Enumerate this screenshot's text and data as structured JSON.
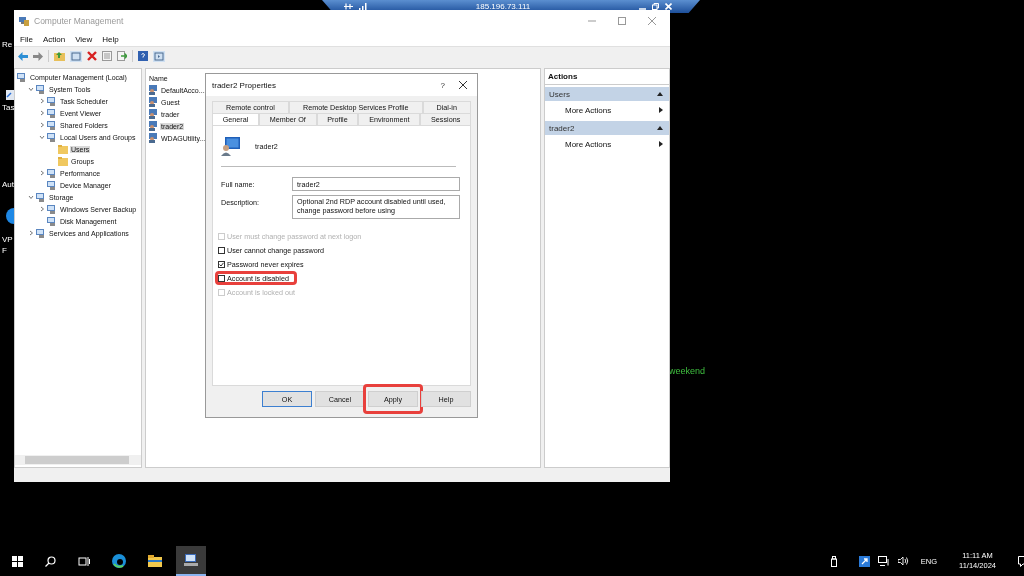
{
  "desktop": {
    "icon_labels": [
      "Re",
      "Tas",
      "Aut",
      "VP",
      "F"
    ],
    "note_text": "weekend"
  },
  "remote_bar": {
    "address": "185.196.73.111"
  },
  "window": {
    "title": "Computer Management",
    "menu": [
      "File",
      "Action",
      "View",
      "Help"
    ]
  },
  "tree": [
    {
      "label": "Computer Management (Local)",
      "selected": false,
      "children": [
        {
          "label": "System Tools",
          "selected": false,
          "expanded": true,
          "children": [
            {
              "label": "Task Scheduler",
              "selected": false,
              "expanded": false
            },
            {
              "label": "Event Viewer",
              "selected": false,
              "expanded": false
            },
            {
              "label": "Shared Folders",
              "selected": false,
              "expanded": false
            },
            {
              "label": "Local Users and Groups",
              "selected": false,
              "expanded": true,
              "children": [
                {
                  "label": "Users",
                  "selected": true
                },
                {
                  "label": "Groups",
                  "selected": false
                }
              ]
            },
            {
              "label": "Performance",
              "selected": false,
              "expanded": false
            },
            {
              "label": "Device Manager",
              "selected": false
            }
          ]
        },
        {
          "label": "Storage",
          "selected": false,
          "expanded": true,
          "children": [
            {
              "label": "Windows Server Backup",
              "selected": false,
              "expanded": false
            },
            {
              "label": "Disk Management",
              "selected": false
            }
          ]
        },
        {
          "label": "Services and Applications",
          "selected": false,
          "expanded": false
        }
      ]
    }
  ],
  "list": {
    "columns": [
      "Name"
    ],
    "rows": [
      {
        "name": "DefaultAcco...",
        "selected": false
      },
      {
        "name": "Guest",
        "selected": false
      },
      {
        "name": "trader",
        "selected": false
      },
      {
        "name": "trader2",
        "selected": true
      },
      {
        "name": "WDAGUtility...",
        "selected": false
      }
    ]
  },
  "actions": {
    "title": "Actions",
    "sections": [
      {
        "title": "Users",
        "items": [
          "More Actions"
        ]
      },
      {
        "title": "trader2",
        "items": [
          "More Actions"
        ]
      }
    ]
  },
  "dialog": {
    "title": "trader2 Properties",
    "help": "?",
    "tabs_back": [
      "Remote control",
      "Remote Desktop Services Profile",
      "Dial-in"
    ],
    "tabs": [
      {
        "label": "General",
        "selected": true
      },
      {
        "label": "Member Of",
        "selected": false
      },
      {
        "label": "Profile",
        "selected": false
      },
      {
        "label": "Environment",
        "selected": false
      },
      {
        "label": "Sessions",
        "selected": false
      }
    ],
    "user_name": "trader2",
    "fields": [
      {
        "label": "Full name:",
        "value": "trader2"
      },
      {
        "label": "Description:",
        "value": "Optional 2nd RDP account disabled until used, change password before using"
      }
    ],
    "options": [
      {
        "label": "User must change password at next logon",
        "checked": false,
        "disabled": true,
        "highlighted": false
      },
      {
        "label": "User cannot change password",
        "checked": false,
        "disabled": false,
        "highlighted": false
      },
      {
        "label": "Password never expires",
        "checked": true,
        "disabled": false,
        "highlighted": false
      },
      {
        "label": "Account is disabled",
        "checked": false,
        "disabled": false,
        "highlighted": true
      },
      {
        "label": "Account is locked out",
        "checked": false,
        "disabled": true,
        "highlighted": false
      }
    ],
    "buttons": [
      {
        "label": "OK",
        "default": true,
        "highlighted": false
      },
      {
        "label": "Cancel",
        "default": false,
        "highlighted": false
      },
      {
        "label": "Apply",
        "default": false,
        "highlighted": true
      },
      {
        "label": "Help",
        "default": false,
        "highlighted": false
      }
    ]
  },
  "taskbar": {
    "language": "ENG",
    "time": "11:11 AM",
    "date": "11/14/2024"
  }
}
